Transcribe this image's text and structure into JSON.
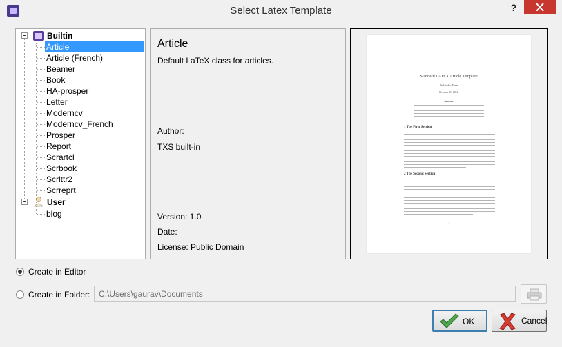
{
  "window": {
    "title": "Select Latex Template",
    "help_label": "?",
    "app_icon": "texstudio-icon",
    "close_icon": "close-icon"
  },
  "tree": {
    "groups": [
      {
        "label": "Builtin",
        "icon": "builtin-icon",
        "items": [
          "Article",
          "Article (French)",
          "Beamer",
          "Book",
          "HA-prosper",
          "Letter",
          "Moderncv",
          "Moderncv_French",
          "Prosper",
          "Report",
          "Scrartcl",
          "Scrbook",
          "Scrlttr2",
          "Scrreprt"
        ]
      },
      {
        "label": "User",
        "icon": "user-icon",
        "items": [
          "blog"
        ]
      }
    ],
    "selected": "Article"
  },
  "info": {
    "title": "Article",
    "description": "Default LaTeX class for articles.",
    "author_heading": "Author:",
    "author": "TXS built-in",
    "version": "Version: 1.0",
    "date": "Date:",
    "license": "License: Public Domain"
  },
  "preview": {
    "title": "Standard LATEX Article Template",
    "author": "TeXstudio Team",
    "date": "October 31, 2012",
    "abstract_heading": "Abstract",
    "section1": "1   The First Section",
    "section2": "2   The Second Section",
    "page_number": "1"
  },
  "options": {
    "create_in_editor": "Create in Editor",
    "create_in_folder": "Create in Folder:",
    "folder_value": "C:\\Users\\gaurav\\Documents",
    "selected": "editor",
    "browse_icon": "printer-icon"
  },
  "buttons": {
    "ok": "OK",
    "cancel": "Cancel",
    "ok_icon": "green-check-icon",
    "cancel_icon": "red-x-icon"
  },
  "colors": {
    "selection": "#3399ff",
    "close_button": "#c7372f",
    "ok_accent": "#3c7fb1"
  }
}
